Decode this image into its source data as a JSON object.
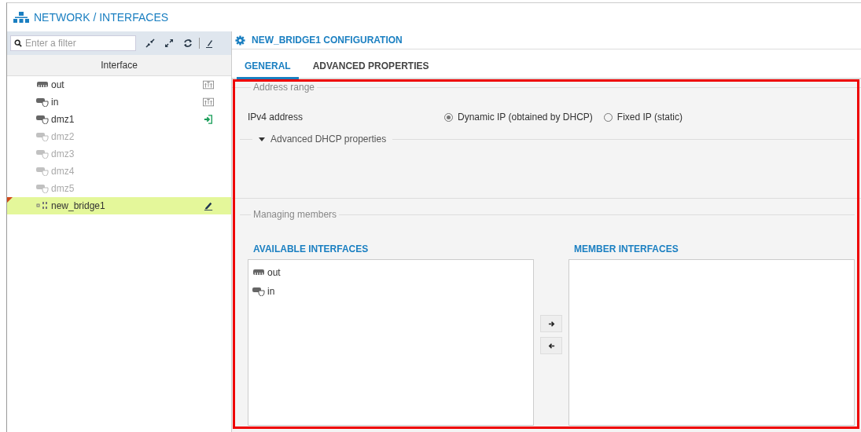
{
  "header": {
    "title": "NETWORK / INTERFACES"
  },
  "sidebar": {
    "filter": {
      "placeholder": "Enter a filter"
    },
    "column": "Interface",
    "items": [
      {
        "label": "out",
        "kind": "plain",
        "badge": {
          "kind": "port"
        },
        "disabled": false,
        "selected": false,
        "modified": false
      },
      {
        "label": "in",
        "kind": "protected",
        "badge": {
          "kind": "port"
        },
        "disabled": false,
        "selected": false,
        "modified": false
      },
      {
        "label": "dmz1",
        "kind": "protected",
        "badge": {
          "kind": "enter"
        },
        "disabled": false,
        "selected": false,
        "modified": false
      },
      {
        "label": "dmz2",
        "kind": "protected",
        "disabled": true,
        "selected": false,
        "modified": false
      },
      {
        "label": "dmz3",
        "kind": "protected",
        "disabled": true,
        "selected": false,
        "modified": false
      },
      {
        "label": "dmz4",
        "kind": "protected",
        "disabled": true,
        "selected": false,
        "modified": false
      },
      {
        "label": "dmz5",
        "kind": "protected",
        "disabled": true,
        "selected": false,
        "modified": false
      },
      {
        "label": "new_bridge1",
        "kind": "bridge",
        "badge": {
          "kind": "edit"
        },
        "disabled": false,
        "selected": true,
        "modified": true
      }
    ]
  },
  "panel": {
    "title": "NEW_BRIDGE1 CONFIGURATION",
    "tabs": [
      {
        "label": "GENERAL",
        "selected": true
      },
      {
        "label": "ADVANCED PROPERTIES",
        "selected": false
      }
    ],
    "address_range": {
      "legend": "Address range",
      "label": "IPv4 address",
      "options": [
        {
          "label": "Dynamic IP (obtained by DHCP)",
          "selected": true
        },
        {
          "label": "Fixed IP (static)",
          "selected": false
        }
      ],
      "dhcp": {
        "label": "Advanced DHCP properties",
        "expanded": true
      }
    },
    "members": {
      "legend": "Managing members",
      "available": {
        "title": "AVAILABLE INTERFACES",
        "items": [
          {
            "label": "out",
            "kind": "plain"
          },
          {
            "label": "in",
            "kind": "protected"
          }
        ]
      },
      "member": {
        "title": "MEMBER INTERFACES"
      }
    }
  }
}
